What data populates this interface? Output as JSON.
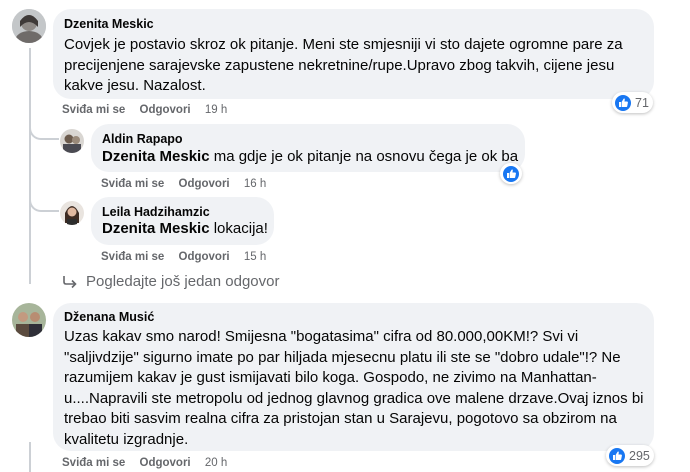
{
  "comments": [
    {
      "author": "Dzenita Meskic",
      "text": "Covjek je postavio skroz ok pitanje. Meni ste smjesniji vi sto dajete ogromne pare za precijenjene sarajevske zapustene nekretnine/rupe.Upravo zbog takvih, cijene jesu kakve jesu. Nazalost.",
      "like_label": "Sviđa mi se",
      "reply_label": "Odgovori",
      "time": "19 h",
      "reactions": "71"
    },
    {
      "author": "Aldin Rapapo",
      "mention": "Dzenita Meskic",
      "text": " ma gdje je ok pitanje na osnovu čega je ok ba",
      "like_label": "Sviđa mi se",
      "reply_label": "Odgovori",
      "time": "16 h"
    },
    {
      "author": "Leila Hadzihamzic",
      "mention": "Dzenita Meskic",
      "text": " lokacija!",
      "like_label": "Sviđa mi se",
      "reply_label": "Odgovori",
      "time": "15 h"
    },
    {
      "author": "Dženana Musić",
      "text": "Uzas kakav smo narod! Smijesna \"bogatasima\" cifra od 80.000,00KM!? Svi vi \"saljivdzije\" sigurno imate po par hiljada mjesecnu platu ili ste se \"dobro udale\"!? Ne razumijem kakav je gust ismijavati bilo koga. Gospodo, ne zivimo na Manhattan-u....Napravili ste metropolu od jednog glavnog gradica ove malene drzave.Ovaj iznos bi trebao biti sasvim realna cifra za pristojan stan u Sarajevu, pogotovo sa obzirom na kvalitetu izgradnje.",
      "like_label": "Sviđa mi se",
      "reply_label": "Odgovori",
      "time": "20 h",
      "reactions": "295"
    }
  ],
  "more_replies": "Pogledajte još jedan odgovor",
  "colors": {
    "bubble": "#f0f2f5",
    "like_blue": "#1877f2",
    "meta": "#65676b"
  }
}
